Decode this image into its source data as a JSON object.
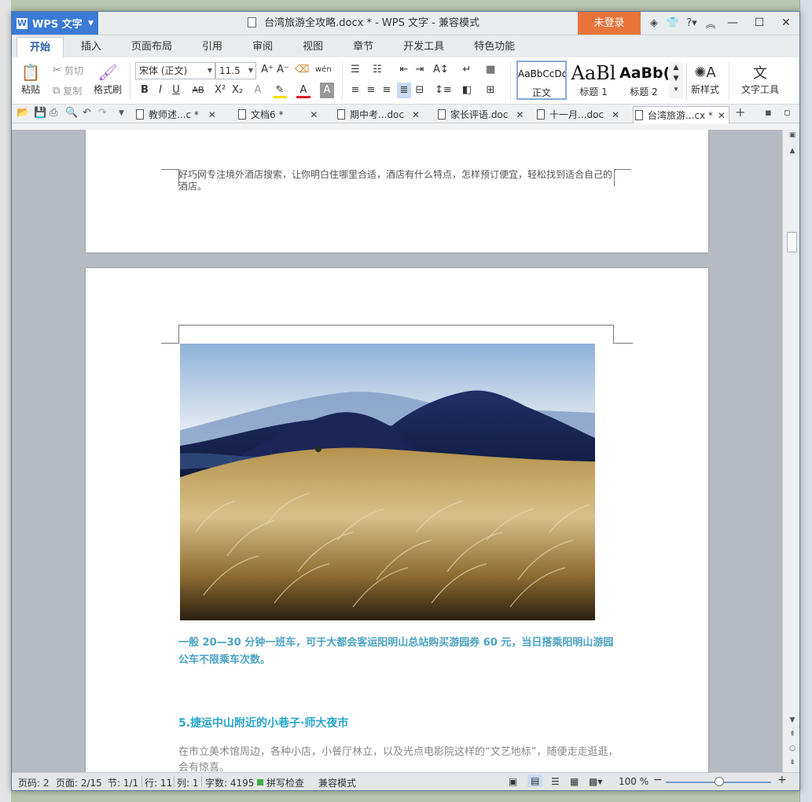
{
  "titlebar": {
    "app_name": "WPS 文字",
    "doc_title": "台湾旅游全攻略.docx * - WPS 文字 - 兼容模式",
    "login": "未登录"
  },
  "menu": {
    "tabs": [
      "开始",
      "插入",
      "页面布局",
      "引用",
      "审阅",
      "视图",
      "章节",
      "开发工具",
      "特色功能"
    ],
    "active": 0
  },
  "ribbon": {
    "paste": "粘贴",
    "cut": "剪切",
    "copy": "复制",
    "format_painter": "格式刷",
    "font_name": "宋体 (正文)",
    "font_size": "11.5",
    "styles": [
      {
        "sample": "AaBbCcDd",
        "label": "正文"
      },
      {
        "sample": "AaBl",
        "label": "标题 1"
      },
      {
        "sample": "AaBb(",
        "label": "标题 2"
      }
    ],
    "new_style": "新样式",
    "text_tools": "文字工具"
  },
  "doc_tabs": [
    {
      "label": "教师述...c *"
    },
    {
      "label": "文档6 *"
    },
    {
      "label": "期中考...doc"
    },
    {
      "label": "家长评语.doc"
    },
    {
      "label": "十一月...doc"
    },
    {
      "label": "台湾旅游...cx *"
    }
  ],
  "document": {
    "footer_note": "好巧网专注境外酒店搜索，让你明白住哪里合适，酒店有什么特点，怎样预订便宜，轻松找到适合自己的酒店。",
    "bus_para": "一般 20—30 分钟一班车，可于大都会客运阳明山总站购买游园券 60 元，当日搭乘阳明山游园公车不限乘车次数。",
    "heading5": "5.捷运中山附近的小巷子·师大夜市",
    "para_partial": "在市立美术馆周边，各种小店，小餐厅林立，以及光点电影院这样的“文艺地标”，随便走走逛逛，会有惊喜。"
  },
  "status": {
    "page_num": "页码: 2",
    "page_of": "页面: 2/15",
    "section": "节: 1/1",
    "line": "行: 11",
    "col": "列: 1",
    "wordcount": "字数: 4195",
    "spellcheck": "拼写检查",
    "compat": "兼容模式",
    "zoom": "100 %"
  },
  "colors": {
    "accent_blue": "#3a7bd5",
    "login_orange": "#e8743b",
    "para_blue": "#4aa3c4",
    "heading_blue": "#2aa6cc"
  }
}
